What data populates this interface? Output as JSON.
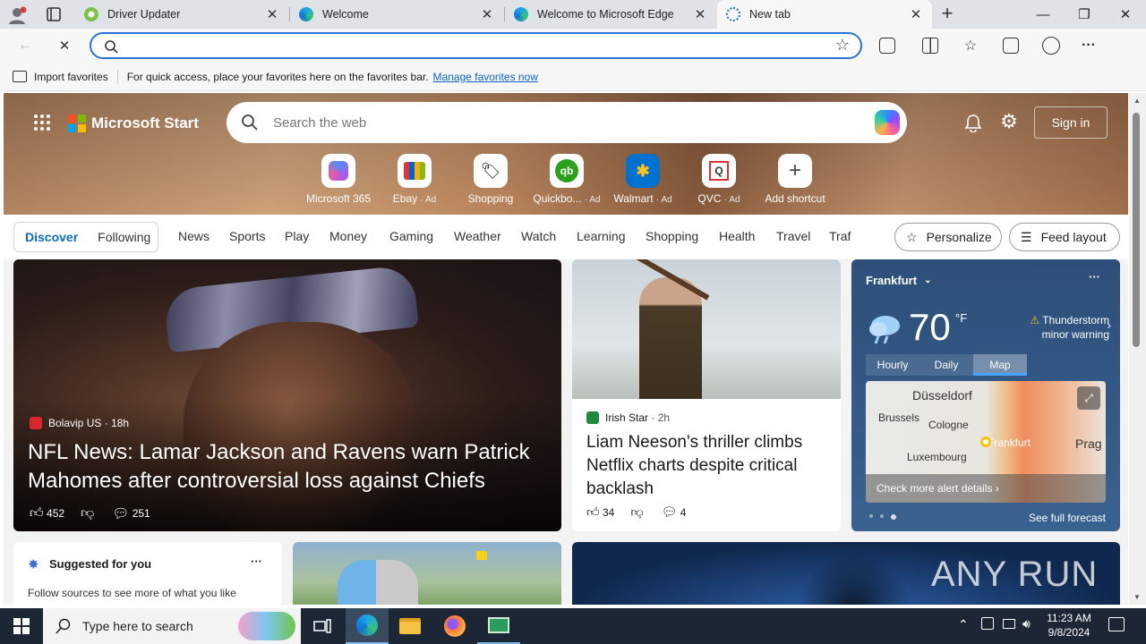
{
  "browser": {
    "tabs": [
      {
        "title": "Driver Updater",
        "active": false
      },
      {
        "title": "Welcome",
        "active": false
      },
      {
        "title": "Welcome to Microsoft Edge",
        "active": false
      },
      {
        "title": "New tab",
        "active": true
      }
    ],
    "address_value": "",
    "favorites_bar": {
      "import_label": "Import favorites",
      "hint": "For quick access, place your favorites here on the favorites bar.",
      "manage_link": "Manage favorites now"
    }
  },
  "start": {
    "brand": "Microsoft Start",
    "search_placeholder": "Search the web",
    "sign_in": "Sign in",
    "shortcuts": [
      {
        "label": "Microsoft 365",
        "ad": ""
      },
      {
        "label": "Ebay",
        "ad": "· Ad"
      },
      {
        "label": "Shopping",
        "ad": ""
      },
      {
        "label": "Quickbo...",
        "ad": "· Ad"
      },
      {
        "label": "Walmart",
        "ad": "· Ad"
      },
      {
        "label": "QVC",
        "ad": "· Ad"
      },
      {
        "label": "Add shortcut",
        "ad": ""
      }
    ],
    "feed_tabs": {
      "discover": "Discover",
      "following": "Following"
    },
    "categories": [
      "News",
      "Sports",
      "Play",
      "Money",
      "Gaming",
      "Weather",
      "Watch",
      "Learning",
      "Shopping",
      "Health",
      "Travel",
      "Traf"
    ],
    "personalize": "Personalize",
    "feed_layout": "Feed layout"
  },
  "cards": {
    "main": {
      "source": "Bolavip US",
      "age": "· 18h",
      "headline": "NFL News: Lamar Jackson and Ravens warn Patrick Mahomes after controversial loss against Chiefs",
      "likes": "452",
      "comments": "251"
    },
    "second": {
      "source": "Irish Star",
      "age": "· 2h",
      "headline": "Liam Neeson's thriller climbs Netflix charts despite critical backlash",
      "likes": "34",
      "comments": "4"
    },
    "weather": {
      "city": "Frankfurt",
      "temp": "70",
      "unit": "°F",
      "alert_line1": "Thunderstorm",
      "alert_line2": "minor warning",
      "tabs": [
        "Hourly",
        "Daily",
        "Map"
      ],
      "active_tab": "Map",
      "map_labels": [
        "Düsseldorf",
        "Brussels",
        "Cologne",
        "Luxembourg",
        "Frankfurt",
        "Prag"
      ],
      "alert_details": "Check more alert details",
      "forecast": "See full forecast"
    },
    "suggested": {
      "title": "Suggested for you",
      "body": "Follow sources to see more of what you like"
    }
  },
  "taskbar": {
    "search_placeholder": "Type here to search",
    "time": "11:23 AM",
    "date": "9/8/2024"
  },
  "watermark": "ANY RUN",
  "colors": {
    "accent": "#0f6cbd",
    "omnibox_border": "#2a73d6",
    "taskbar": "#1c2634"
  }
}
